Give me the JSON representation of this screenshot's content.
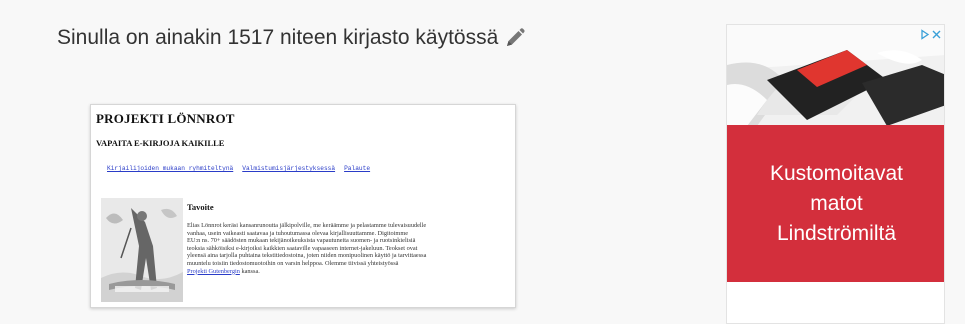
{
  "headline": {
    "text": "Sinulla on ainakin 1517 niteen kirjasto käytössä",
    "edit_icon": "pencil-icon"
  },
  "preview": {
    "title": "PROJEKTI LÖNNROT",
    "subtitle": "VAPAITA E-KIRJOJA KAIKILLE",
    "links": [
      "Kirjailijoiden mukaan ryhmiteltynä",
      "Valmistumisjärjestyksessä",
      "Palaute"
    ],
    "section_title": "Tavoite",
    "body_lines": [
      "Elias Lönnrot keräsi kansanrunoutta jälkipolville, me keräämme ja pelastamme tulevaisuudelle",
      "vanhaa, usein vaikeasti saatavaa ja tuhoutumassa olevaa kirjallisuuttamme. Digitoimme",
      "EU:n ns. 70+ säädösten mukaan tekijänoikeuksista vapautuneita suomen- ja ruotsinkielisiä",
      "teoksia sähköisiksi e-kirjoiksi kaikkien saataville vapaaseen internet-jakeluun. Teokset ovat",
      "yleensä aina tarjolla puhtaina tekstitiedostoina, joten niiden monipuolinen käyttö ja tarvittaessa",
      "muuntelu toisiin tiedostomuotoihin on varsin helppoa. Olemme tiivissä yhteistyössä"
    ],
    "body_link": "Projekti Gutenbergin",
    "body_tail": " kanssa."
  },
  "ad": {
    "choices_icons": [
      "adchoices-icon",
      "close-icon"
    ],
    "text": "Kustomoitavat matot Lindströmiltä",
    "colors": {
      "panel": "#d32f3c"
    }
  }
}
